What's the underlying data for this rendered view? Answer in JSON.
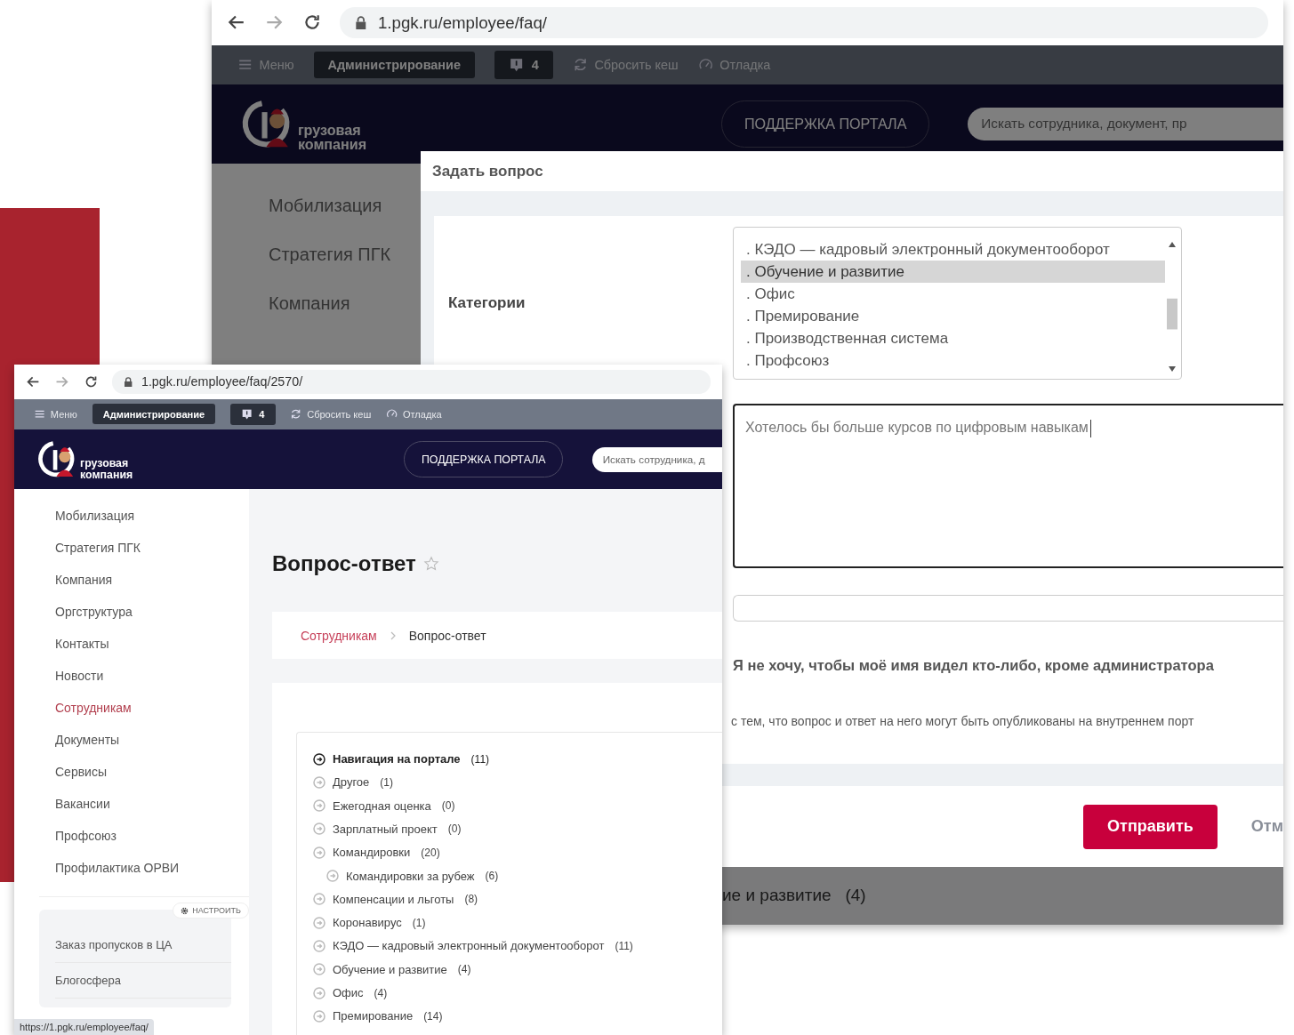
{
  "back_window": {
    "url": "1.pgk.ru/employee/faq/",
    "admin_bar": {
      "menu": "Меню",
      "admin": "Администрирование",
      "notifications": "4",
      "reset_cache": "Сбросить кеш",
      "debug": "Отладка"
    },
    "header": {
      "logo_lines": [
        "грузовая",
        "компания"
      ],
      "support": "ПОДДЕРЖКА ПОРТАЛА",
      "search_placeholder": "Искать сотрудника, документ, пр"
    },
    "sidebar": [
      {
        "label": "Мобилизация"
      },
      {
        "label": "Стратегия ПГК"
      },
      {
        "label": "Компания"
      }
    ],
    "background_fragment": "ие и развитие   (4)",
    "modal": {
      "title": "Задать вопрос",
      "category_label": "Категории",
      "categories": [
        {
          "label": ". КЭДО — кадровый электронный документооборот",
          "selected": false
        },
        {
          "label": ". Обучение и развитие",
          "selected": true
        },
        {
          "label": ". Офис",
          "selected": false
        },
        {
          "label": ". Премирование",
          "selected": false
        },
        {
          "label": ". Производственная система",
          "selected": false
        },
        {
          "label": ". Профсоюз",
          "selected": false
        }
      ],
      "question": "Хотелось бы больше курсов по цифровым навыкам",
      "anonymous_label": "Я не хочу, чтобы моё имя видел кто-либо, кроме администратора",
      "consent": "с тем, что вопрос и ответ на него могут быть опубликованы на внутреннем порт",
      "submit": "Отправить",
      "cancel": "Отм"
    }
  },
  "front_window": {
    "url": "1.pgk.ru/employee/faq/2570/",
    "admin_bar": {
      "menu": "Меню",
      "admin": "Администрирование",
      "notifications": "4",
      "reset_cache": "Сбросить кеш",
      "debug": "Отладка"
    },
    "header": {
      "logo_lines": [
        "грузовая",
        "компания"
      ],
      "support": "ПОДДЕРЖКА ПОРТАЛА",
      "search_placeholder": "Искать сотрудника, д"
    },
    "sidebar": [
      {
        "label": "Мобилизация",
        "selected": false
      },
      {
        "label": "Стратегия ПГК",
        "selected": false
      },
      {
        "label": "Компания",
        "selected": false
      },
      {
        "label": "Оргструктура",
        "selected": false
      },
      {
        "label": "Контакты",
        "selected": false
      },
      {
        "label": "Новости",
        "selected": false
      },
      {
        "label": "Сотрудникам",
        "selected": true
      },
      {
        "label": "Документы",
        "selected": false
      },
      {
        "label": "Сервисы",
        "selected": false
      },
      {
        "label": "Вакансии",
        "selected": false
      },
      {
        "label": "Профсоюз",
        "selected": false
      },
      {
        "label": "Профилактика ОРВИ",
        "selected": false
      }
    ],
    "widget": {
      "settings": "НАСТРОИТЬ",
      "links": [
        "Заказ пропусков в ЦА",
        "Блогосфера"
      ]
    },
    "status_url": "https://1.pgk.ru/employee/faq/",
    "title": "Вопрос-ответ",
    "breadcrumbs": [
      {
        "label": "Сотрудникам",
        "kind": "link"
      },
      {
        "label": "Вопрос-ответ",
        "kind": "current"
      }
    ],
    "tree": [
      {
        "label": "Навигация на портале",
        "count": "(11)",
        "selected": true
      },
      {
        "label": "Другое",
        "count": "(1)",
        "selected": false
      },
      {
        "label": "Ежегодная оценка",
        "count": "(0)",
        "selected": false
      },
      {
        "label": "Зарплатный проект",
        "count": "(0)",
        "selected": false
      },
      {
        "label": "Командировки",
        "count": "(20)",
        "selected": false,
        "children": [
          {
            "label": "Командировки за рубеж",
            "count": "(6)",
            "selected": false
          }
        ]
      },
      {
        "label": "Компенсации и льготы",
        "count": "(8)",
        "selected": false
      },
      {
        "label": "Коронавирус",
        "count": "(1)",
        "selected": false
      },
      {
        "label": "КЭДО — кадровый электронный документооборот",
        "count": "(11)",
        "selected": false
      },
      {
        "label": "Обучение и развитие",
        "count": "(4)",
        "selected": false
      },
      {
        "label": "Офис",
        "count": "(4)",
        "selected": false
      },
      {
        "label": "Премирование",
        "count": "(14)",
        "selected": false
      }
    ]
  }
}
